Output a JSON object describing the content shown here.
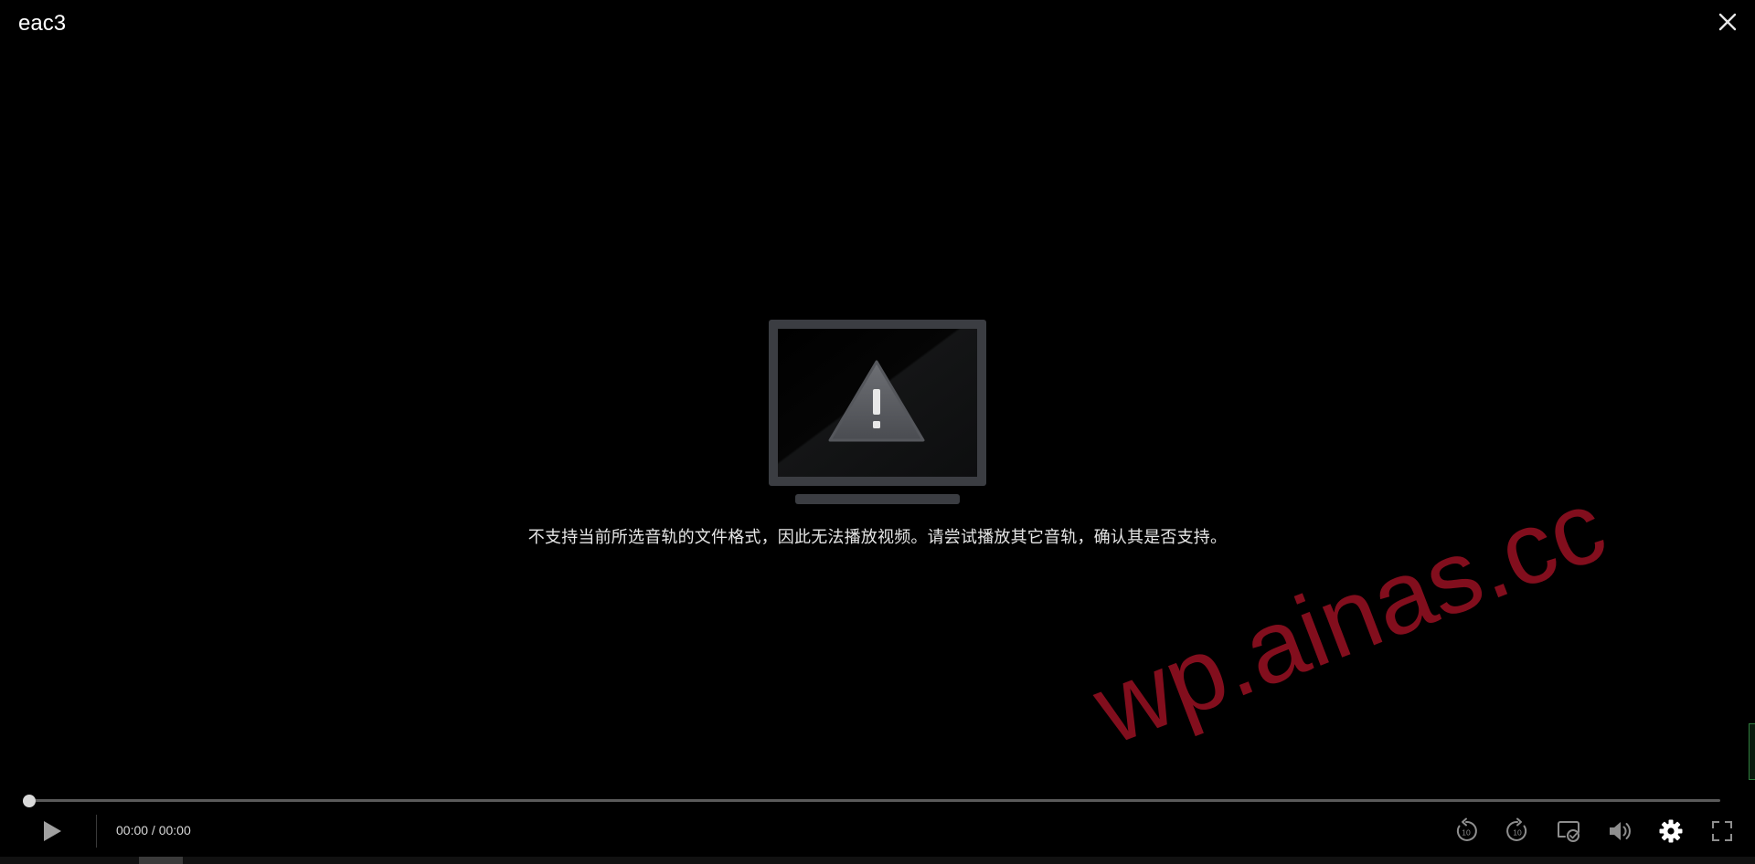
{
  "window": {
    "title": "eac3"
  },
  "error": {
    "message": "不支持当前所选音轨的文件格式，因此无法播放视频。请尝试播放其它音轨，确认其是否支持。",
    "icon": "monitor-warning-icon"
  },
  "watermark": {
    "text": "wp.ainas.cc",
    "color": "#8a0f1f"
  },
  "player": {
    "time_display": "00:00 / 00:00",
    "progress": 0,
    "controls": [
      {
        "name": "rewind-10-icon",
        "label": "10"
      },
      {
        "name": "forward-10-icon",
        "label": "10"
      },
      {
        "name": "cast-icon"
      },
      {
        "name": "volume-icon"
      },
      {
        "name": "settings-icon"
      },
      {
        "name": "fullscreen-icon"
      }
    ]
  },
  "colors": {
    "background": "#000000",
    "text": "#e6e6e6",
    "icon": "#9a9a9a",
    "icon_active": "#ffffff"
  }
}
